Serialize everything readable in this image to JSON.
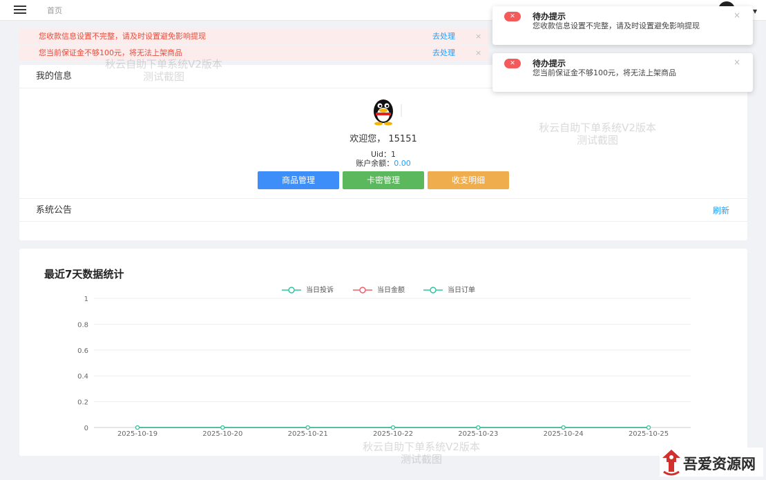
{
  "header": {
    "breadcrumb": "首页"
  },
  "alerts": [
    {
      "message": "您收款信息设置不完整，请及时设置避免影响提现",
      "action": "去处理",
      "close": "×"
    },
    {
      "message": "您当前保证金不够100元，将无法上架商品",
      "action": "去处理",
      "close": "×"
    }
  ],
  "info_card": {
    "title": "我的信息",
    "welcome": "欢迎您，  15151",
    "uid": "Uid：1",
    "balance_label": "账户余额：",
    "balance_value": "0.00",
    "buttons": {
      "goods": "商品管理",
      "cards": "卡密管理",
      "bills": "收支明细"
    }
  },
  "notice": {
    "title": "系统公告",
    "refresh": "刷新"
  },
  "chart_card": {
    "title": "最近7天数据统计"
  },
  "chart_data": {
    "type": "line",
    "x": [
      "2025-10-19",
      "2025-10-20",
      "2025-10-21",
      "2025-10-22",
      "2025-10-23",
      "2025-10-24",
      "2025-10-25"
    ],
    "series": [
      {
        "name": "当日投诉",
        "values": [
          0,
          0,
          0,
          0,
          0,
          0,
          0
        ],
        "color": "#2ec7a1"
      },
      {
        "name": "当日金额",
        "values": [
          0,
          0,
          0,
          0,
          0,
          0,
          0
        ],
        "color": "#f25e6b"
      },
      {
        "name": "当日订单",
        "values": [
          0,
          0,
          0,
          0,
          0,
          0,
          0
        ],
        "color": "#2ec7a1"
      }
    ],
    "yticks": [
      "0",
      "0.2",
      "0.4",
      "0.6",
      "0.8",
      "1"
    ],
    "ylim": [
      0,
      1
    ],
    "grid": true,
    "legend": "top-center"
  },
  "toasts": [
    {
      "title": "待办提示",
      "body": "您收款信息设置不完整，请及时设置避免影响提现",
      "close": "×",
      "icon": "✕"
    },
    {
      "title": "待办提示",
      "body": "您当前保证金不够100元，将无法上架商品",
      "close": "×",
      "icon": "✕"
    }
  ],
  "watermark": {
    "line1": "秋云自助下单系统V2版本",
    "line2": "测试截图"
  },
  "logo": {
    "text": "吾爱资源网"
  }
}
